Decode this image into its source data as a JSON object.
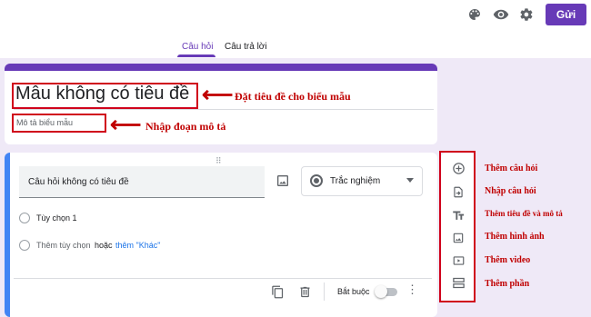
{
  "header": {
    "send_label": "Gửi",
    "icons": [
      "palette-icon",
      "eye-icon",
      "gear-icon"
    ]
  },
  "tabs": [
    {
      "label": "Câu hỏi",
      "active": true
    },
    {
      "label": "Câu trả lời",
      "active": false
    }
  ],
  "form": {
    "title": "Mẫu không có tiêu đề",
    "description_placeholder": "Mô tả biểu mẫu"
  },
  "question": {
    "title": "Câu hỏi không có tiêu đề",
    "type": "Trắc nghiệm",
    "options": [
      {
        "label": "Tùy chọn 1"
      }
    ],
    "add_option": {
      "label": "Thêm tùy chọn",
      "or_text": "hoặc",
      "other_link": "thêm \"Khác\""
    },
    "required_label": "Bắt buộc",
    "required": false
  },
  "toolbar": {
    "items": [
      {
        "icon": "add-circle-icon"
      },
      {
        "icon": "import-icon"
      },
      {
        "icon": "text-icon"
      },
      {
        "icon": "image-icon"
      },
      {
        "icon": "video-icon"
      },
      {
        "icon": "section-icon"
      }
    ]
  },
  "annotations": {
    "title_note": "Đặt tiêu đề cho biểu mẫu",
    "desc_note": "Nhập đoạn mô tả",
    "toolbar_notes": [
      "Thêm câu hỏi",
      "Nhập câu hỏi",
      "Thêm tiêu đề và mô tả",
      "Thêm hình ảnh",
      "Thêm video",
      "Thêm phần"
    ]
  },
  "colors": {
    "accent": "#673ab7",
    "question_accent": "#4285f4",
    "annotation": "#c00000"
  }
}
